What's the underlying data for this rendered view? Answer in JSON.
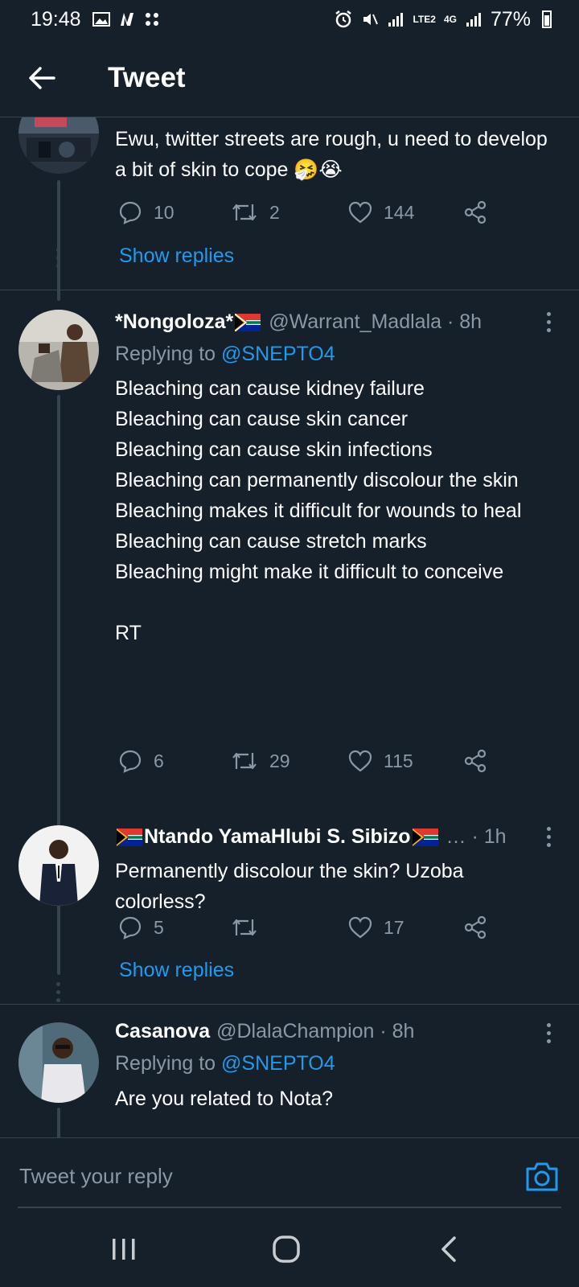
{
  "status_bar": {
    "time": "19:48",
    "network_5g_label": "LTE2",
    "network_4g_label": "4G",
    "battery_percent": "77%"
  },
  "header": {
    "title": "Tweet"
  },
  "tweets": [
    {
      "text": "Ewu, twitter streets are rough, u need to develop a bit of skin to cope 🤧😭",
      "replies": "10",
      "retweets": "2",
      "likes": "144",
      "show_replies_label": "Show replies"
    },
    {
      "name": "*Nongoloza*",
      "handle": "@Warrant_Madlala · 8h",
      "replying_prefix": "Replying to",
      "replying_to": "@SNEPTO4",
      "lines": [
        "Bleaching can cause kidney failure",
        "Bleaching can cause skin cancer",
        "Bleaching can cause skin infections",
        "Bleaching can permanently discolour the skin",
        "Bleaching makes it difficult for wounds to heal",
        "Bleaching can cause stretch marks",
        "Bleaching might make it difficult to conceive",
        "",
        "RT"
      ],
      "replies": "6",
      "retweets": "29",
      "likes": "115"
    },
    {
      "name": "Ntando YamaHlubi S. Sibizo",
      "handle": "… · 1h",
      "text": "Permanently discolour the skin? Uzoba colorless?",
      "replies": "5",
      "retweets": "",
      "likes": "17",
      "show_replies_label": "Show replies"
    },
    {
      "name": "Casanova",
      "handle": "@DlalaChampion · 8h",
      "replying_prefix": "Replying to",
      "replying_to": "@SNEPTO4",
      "text": "Are you related to Nota?"
    }
  ],
  "reply_bar": {
    "placeholder": "Tweet your reply"
  },
  "colors": {
    "background": "#15202b",
    "accent": "#1d9bf0",
    "secondary_text": "#8b98a5",
    "divider": "#38444d"
  },
  "icons": {
    "back": "arrow-left-icon",
    "reply": "speech-bubble-icon",
    "retweet": "retweet-icon",
    "like": "heart-icon",
    "share": "share-icon",
    "more": "vertical-ellipsis-icon",
    "camera": "camera-icon"
  }
}
